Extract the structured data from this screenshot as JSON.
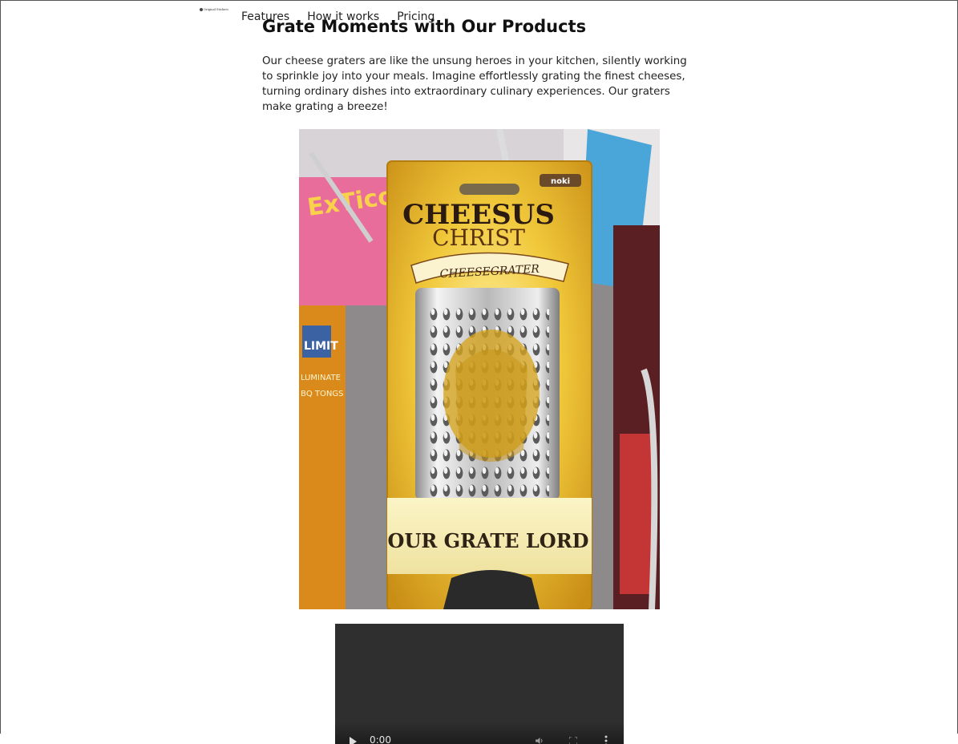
{
  "header": {
    "logo_text": "Original Stickers",
    "nav": [
      {
        "label": "Features"
      },
      {
        "label": "How it works"
      },
      {
        "label": "Pricing"
      }
    ]
  },
  "section": {
    "title": "Grate Moments with Our Products",
    "text": "Our cheese graters are like the unsung heroes in your kitchen, silently working to sprinkle joy into your meals. Imagine effortlessly grating the finest cheeses, turning ordinary dishes into extraordinary culinary experiences. Our graters make grating a breeze!"
  },
  "product_image": {
    "brand": "noki",
    "package_title_line1": "CHEESUS",
    "package_title_line2": "CHRIST",
    "banner_text": "CHEESEGRATER",
    "band_text": "OUR GRATE LORD",
    "side_box_text_1": "LIMIT",
    "side_box_text_2": "LUMINATE",
    "side_box_text_3": "BQ TONGS",
    "bg_sign_text": "ExTico"
  },
  "video": {
    "current_time": "0:00"
  },
  "colors": {
    "package_yellow": "#e8b92c",
    "video_bg": "#2f2f2f"
  }
}
